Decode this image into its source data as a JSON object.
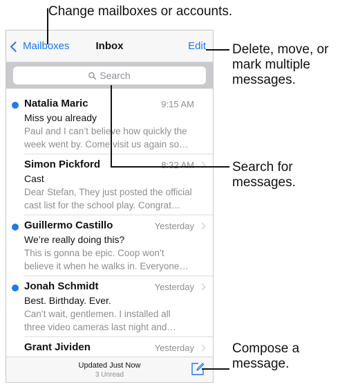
{
  "callouts": {
    "mailboxes": "Change mailboxes or accounts.",
    "edit": "Delete, move, or mark multiple messages.",
    "search": "Search for messages.",
    "compose": "Compose a message."
  },
  "nav": {
    "back_label": "Mailboxes",
    "title": "Inbox",
    "edit_label": "Edit"
  },
  "search": {
    "placeholder": "Search"
  },
  "messages": [
    {
      "sender": "Natalia Maric",
      "time": "9:15 AM",
      "subject": "Miss you already",
      "preview1": "Paul and I can’t believe how quickly the",
      "preview2": "week went by. Come visit us again so…",
      "unread": true
    },
    {
      "sender": "Simon Pickford",
      "time": "8:32 AM",
      "subject": "Cast",
      "preview1": "Dear Stefan, They just posted the official",
      "preview2": "cast list for the school play. Congrat…",
      "unread": false
    },
    {
      "sender": "Guillermo Castillo",
      "time": "Yesterday",
      "subject": "We’re really doing this?",
      "preview1": "This is gonna be epic. Coop won’t",
      "preview2": "believe it when he walks in. Everyone…",
      "unread": true
    },
    {
      "sender": "Jonah Schmidt",
      "time": "Yesterday",
      "subject": "Best. Birthday. Ever.",
      "preview1": "Can’t wait, gentlemen. I installed all",
      "preview2": "three video cameras last night and…",
      "unread": true
    },
    {
      "sender": "Grant Jividen",
      "time": "Yesterday",
      "subject": "",
      "preview1": "",
      "preview2": "",
      "unread": false
    }
  ],
  "toolbar": {
    "status": "Updated Just Now",
    "unread_count": "3 Unread"
  },
  "colors": {
    "accent": "#1878f5",
    "unread_dot": "#1f7aea"
  }
}
